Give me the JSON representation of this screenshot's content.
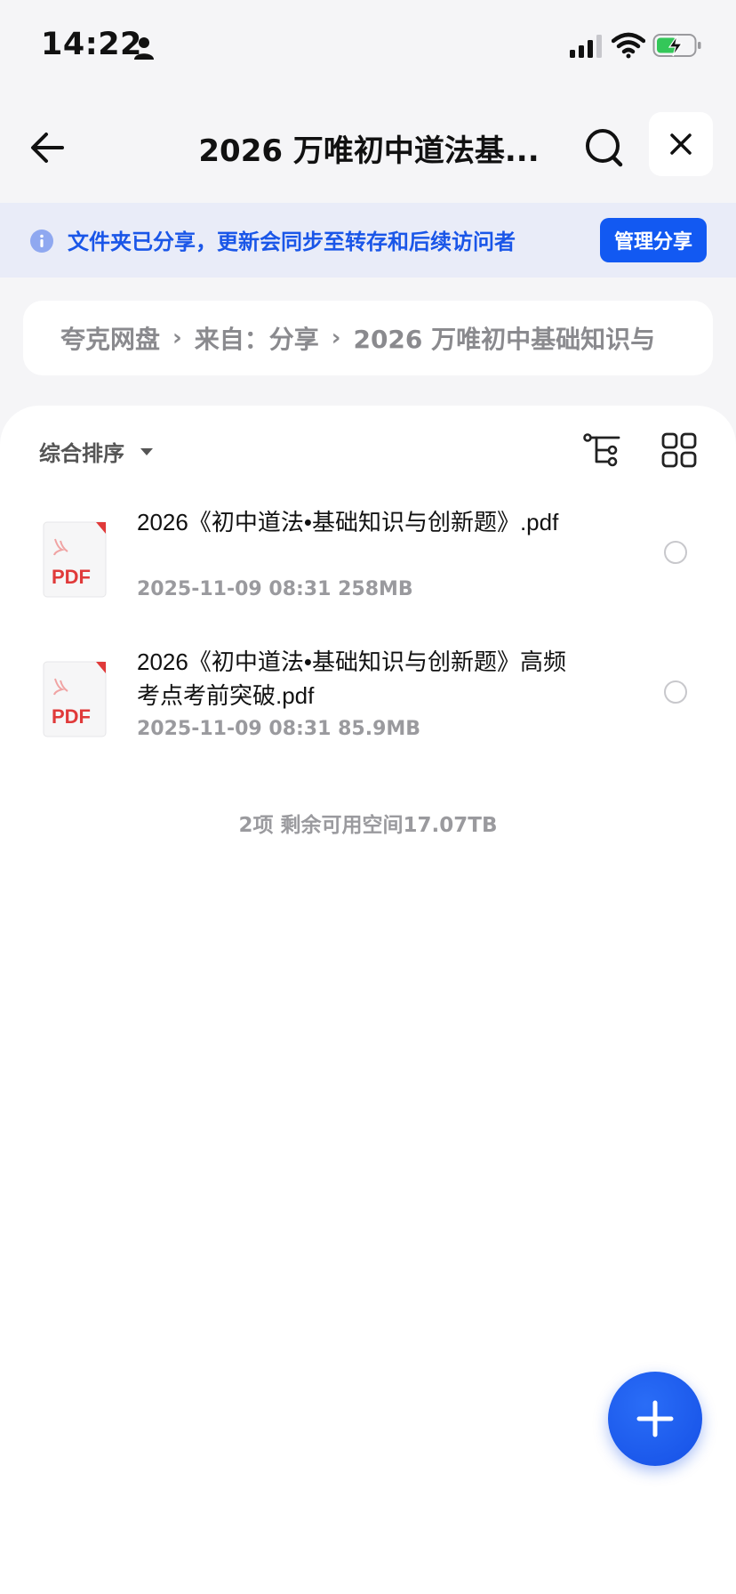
{
  "status_bar": {
    "time": "14:22"
  },
  "nav": {
    "title": "2026 万唯初中道法基..."
  },
  "banner": {
    "text": "文件夹已分享，更新会同步至转存和后续访问者",
    "manage_label": "管理分享"
  },
  "breadcrumb": {
    "items": [
      "夸克网盘",
      "来自：分享",
      "2026 万唯初中基础知识与"
    ]
  },
  "toolbar": {
    "sort_label": "综合排序"
  },
  "files": [
    {
      "name": "2026《初中道法•基础知识与创新题》.pdf",
      "date": "2025-11-09 08:31",
      "size": "258MB",
      "thumb_label": "PDF"
    },
    {
      "name": "2026《初中道法•基础知识与创新题》高频考点考前突破.pdf",
      "date": "2025-11-09 08:31",
      "size": "85.9MB",
      "thumb_label": "PDF"
    }
  ],
  "summary": "2项 剩余可用空间17.07TB",
  "colors": {
    "accent": "#1259f2",
    "banner_bg": "#e9ecf8",
    "pdf_red": "#e03a3a"
  }
}
